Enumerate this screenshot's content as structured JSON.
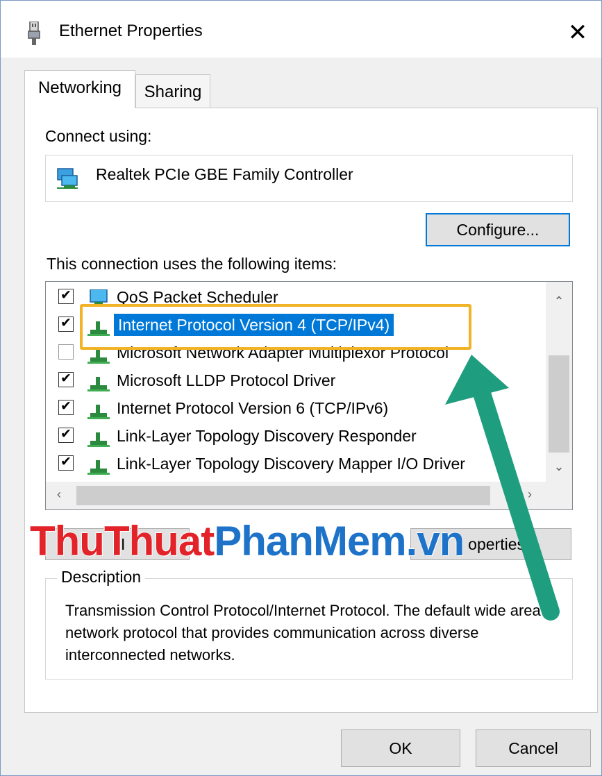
{
  "window": {
    "title": "Ethernet Properties",
    "close_glyph": "✕"
  },
  "tabs": [
    {
      "label": "Networking"
    },
    {
      "label": "Sharing"
    }
  ],
  "networking": {
    "connect_using_label": "Connect using:",
    "adapter_name": "Realtek PCIe GBE Family Controller",
    "configure_label": "Configure...",
    "items_label": "This connection uses the following items:",
    "items": [
      {
        "label": "QoS Packet Scheduler",
        "checked": true,
        "icon": "qos-icon"
      },
      {
        "label": "Internet Protocol Version 4 (TCP/IPv4)",
        "checked": true,
        "icon": "network-protocol-icon",
        "selected": true
      },
      {
        "label": "Microsoft Network Adapter Multiplexor Protocol",
        "checked": false,
        "icon": "network-protocol-icon"
      },
      {
        "label": "Microsoft LLDP Protocol Driver",
        "checked": true,
        "icon": "network-protocol-icon"
      },
      {
        "label": "Internet Protocol Version 6 (TCP/IPv6)",
        "checked": true,
        "icon": "network-protocol-icon"
      },
      {
        "label": "Link-Layer Topology Discovery Responder",
        "checked": true,
        "icon": "network-protocol-icon"
      },
      {
        "label": "Link-Layer Topology Discovery Mapper I/O Driver",
        "checked": true,
        "icon": "network-protocol-icon"
      }
    ],
    "install_label_partial": "I",
    "properties_label_partial": "operties",
    "description_legend": "Description",
    "description_text": "Transmission Control Protocol/Internet Protocol. The default wide area network protocol that provides communication across diverse interconnected networks."
  },
  "watermark": {
    "part1": "ThuThuat",
    "part2": "PhanMem",
    "part3": ".vn"
  },
  "footer": {
    "ok_label": "OK",
    "cancel_label": "Cancel"
  },
  "colors": {
    "selection": "#0078d7",
    "highlight_box": "#f2b327",
    "arrow": "#1f9e7f",
    "watermark_red": "#e3232a",
    "watermark_blue": "#1e73c8"
  }
}
